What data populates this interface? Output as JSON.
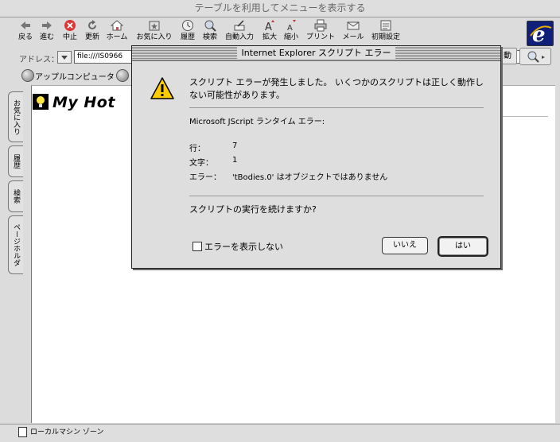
{
  "window": {
    "title": "テーブルを利用してメニューを表示する"
  },
  "toolbar": {
    "buttons": [
      {
        "label": "戻る",
        "icon": "back-arrow-icon"
      },
      {
        "label": "進む",
        "icon": "forward-arrow-icon"
      },
      {
        "label": "中止",
        "icon": "stop-icon"
      },
      {
        "label": "更新",
        "icon": "refresh-icon"
      },
      {
        "label": "ホーム",
        "icon": "home-icon"
      },
      {
        "label": "お気に入り",
        "icon": "favorites-icon"
      },
      {
        "label": "履歴",
        "icon": "history-icon"
      },
      {
        "label": "検索",
        "icon": "search-icon"
      },
      {
        "label": "自動入力",
        "icon": "autofill-icon"
      },
      {
        "label": "拡大",
        "icon": "enlarge-text-icon"
      },
      {
        "label": "縮小",
        "icon": "shrink-text-icon"
      },
      {
        "label": "プリント",
        "icon": "print-icon"
      },
      {
        "label": "メール",
        "icon": "mail-icon"
      },
      {
        "label": "初期設定",
        "icon": "preferences-icon"
      }
    ]
  },
  "address": {
    "label": "アドレス：",
    "value": "file:///IS0966",
    "go_label": "動"
  },
  "favorites_bar": {
    "items": [
      {
        "label": "アップルコンピュータ"
      }
    ]
  },
  "page": {
    "logo_text": "My Hot"
  },
  "side_tabs": [
    {
      "label": "お気に入り"
    },
    {
      "label": "履歴"
    },
    {
      "label": "検索"
    },
    {
      "label": "ページホルダ"
    }
  ],
  "status": {
    "text": "ローカルマシン ゾーン"
  },
  "dialog": {
    "title": "Internet Explorer スクリプト エラー",
    "message": "スクリプト エラーが発生しました。 いくつかのスクリプトは正しく動作しない可能性があります。",
    "engine": "Microsoft JScript ランタイム エラー:",
    "line_label": "行：",
    "line_value": "7",
    "char_label": "文字：",
    "char_value": "1",
    "error_label": "エラー：",
    "error_value": "'tBodies.0' はオブジェクトではありません",
    "question": "スクリプトの実行を続けますか?",
    "checkbox_label": "エラーを表示しない",
    "no_label": "いいえ",
    "yes_label": "はい"
  },
  "colors": {
    "window_bg": "#dcdcdc",
    "content_bg": "#ffffff",
    "warning_yellow": "#ffcc00",
    "ie_blue": "#10207a"
  }
}
